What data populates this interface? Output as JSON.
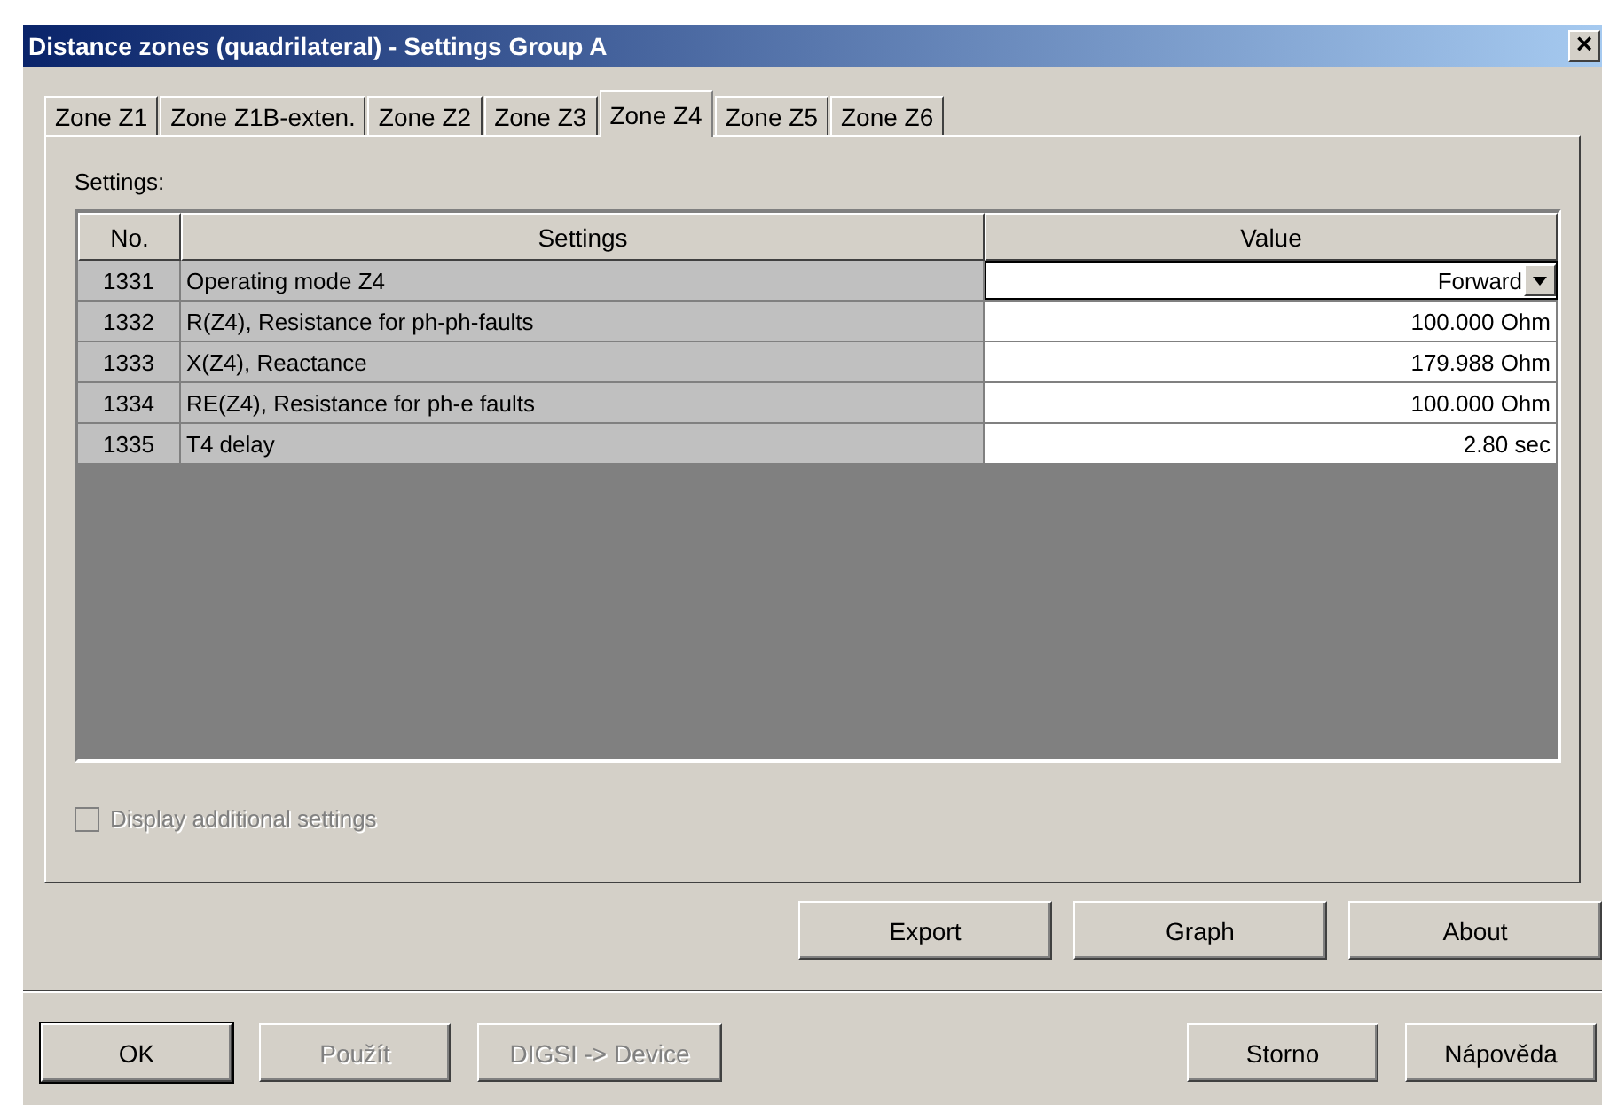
{
  "window": {
    "title": "Distance zones (quadrilateral) - Settings Group A",
    "close": "×"
  },
  "tabs": [
    {
      "label": "Zone Z1",
      "selected": false
    },
    {
      "label": "Zone Z1B-exten.",
      "selected": false
    },
    {
      "label": "Zone Z2",
      "selected": false
    },
    {
      "label": "Zone Z3",
      "selected": false
    },
    {
      "label": "Zone Z4",
      "selected": true
    },
    {
      "label": "Zone Z5",
      "selected": false
    },
    {
      "label": "Zone Z6",
      "selected": false
    }
  ],
  "settings_label": "Settings:",
  "table": {
    "columns": [
      "No.",
      "Settings",
      "Value"
    ],
    "rows": [
      {
        "no": "1331",
        "setting": "Operating mode Z4",
        "value": "Forward",
        "kind": "dropdown"
      },
      {
        "no": "1332",
        "setting": "R(Z4), Resistance for ph-ph-faults",
        "value": "100.000 Ohm",
        "kind": "text"
      },
      {
        "no": "1333",
        "setting": "X(Z4), Reactance",
        "value": "179.988 Ohm",
        "kind": "text"
      },
      {
        "no": "1334",
        "setting": "RE(Z4), Resistance for ph-e faults",
        "value": "100.000 Ohm",
        "kind": "text"
      },
      {
        "no": "1335",
        "setting": "T4 delay",
        "value": "2.80 sec",
        "kind": "text"
      }
    ]
  },
  "additional_settings": {
    "label": "Display additional settings",
    "checked": false,
    "disabled": true
  },
  "tool_buttons": [
    {
      "label": "Export",
      "disabled": false
    },
    {
      "label": "Graph",
      "disabled": false
    },
    {
      "label": "About",
      "disabled": false
    }
  ],
  "dialog_buttons_left": [
    {
      "label": "OK",
      "disabled": false,
      "default": true
    },
    {
      "label": "Použít",
      "disabled": true,
      "default": false
    },
    {
      "label": "DIGSI -> Device",
      "disabled": true,
      "default": false
    }
  ],
  "dialog_buttons_right": [
    {
      "label": "Storno",
      "disabled": false,
      "default": false
    },
    {
      "label": "Nápověda",
      "disabled": false,
      "default": false
    }
  ]
}
